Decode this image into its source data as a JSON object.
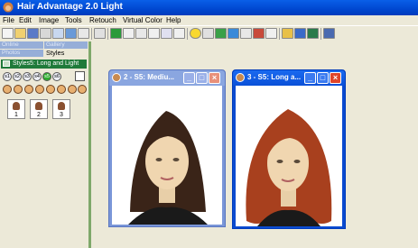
{
  "window": {
    "title": "Hair Advantage 2.0 Light"
  },
  "menu": [
    "File",
    "Edit",
    "Image",
    "Tools",
    "Retouch",
    "Virtual Color",
    "Help"
  ],
  "toolbar": {
    "icons": [
      "new-icon",
      "open-icon",
      "save-icon",
      "print-icon",
      "copy-icon",
      "paste-icon",
      "transfer-icon",
      "email-icon",
      "camera-icon",
      "select-icon",
      "rotate-icon",
      "crop-icon",
      "grid-icon",
      "image-icon",
      "smiley-icon",
      "grid2-icon",
      "mirror-icon",
      "compare-icon",
      "wand-icon",
      "brush-icon",
      "palette-icon",
      "help-icon",
      "tools-icon",
      "globe-icon",
      "info-icon"
    ]
  },
  "sidebar": {
    "tabs_top": [
      "Online",
      "Gallery"
    ],
    "tabs_bottom": [
      "Photos",
      "Styles"
    ],
    "styles_header": "Styles5: Long and Light",
    "style_buttons": [
      "s1",
      "s2",
      "s3",
      "s4",
      "s5",
      "s6"
    ],
    "active_style": "s5",
    "thumbnails": [
      "1",
      "2",
      "3"
    ]
  },
  "windows": [
    {
      "title": "2 - S5: Mediu...",
      "hair_color": "#3a2418",
      "active": false
    },
    {
      "title": "3 - S5: Long a...",
      "hair_color": "#a8401e",
      "active": true
    }
  ],
  "colors": {
    "title_blue": "#0a5fe8",
    "inactive_blue": "#7a96d8",
    "close_red": "#e0452a",
    "styles_green": "#1f7a3a"
  }
}
